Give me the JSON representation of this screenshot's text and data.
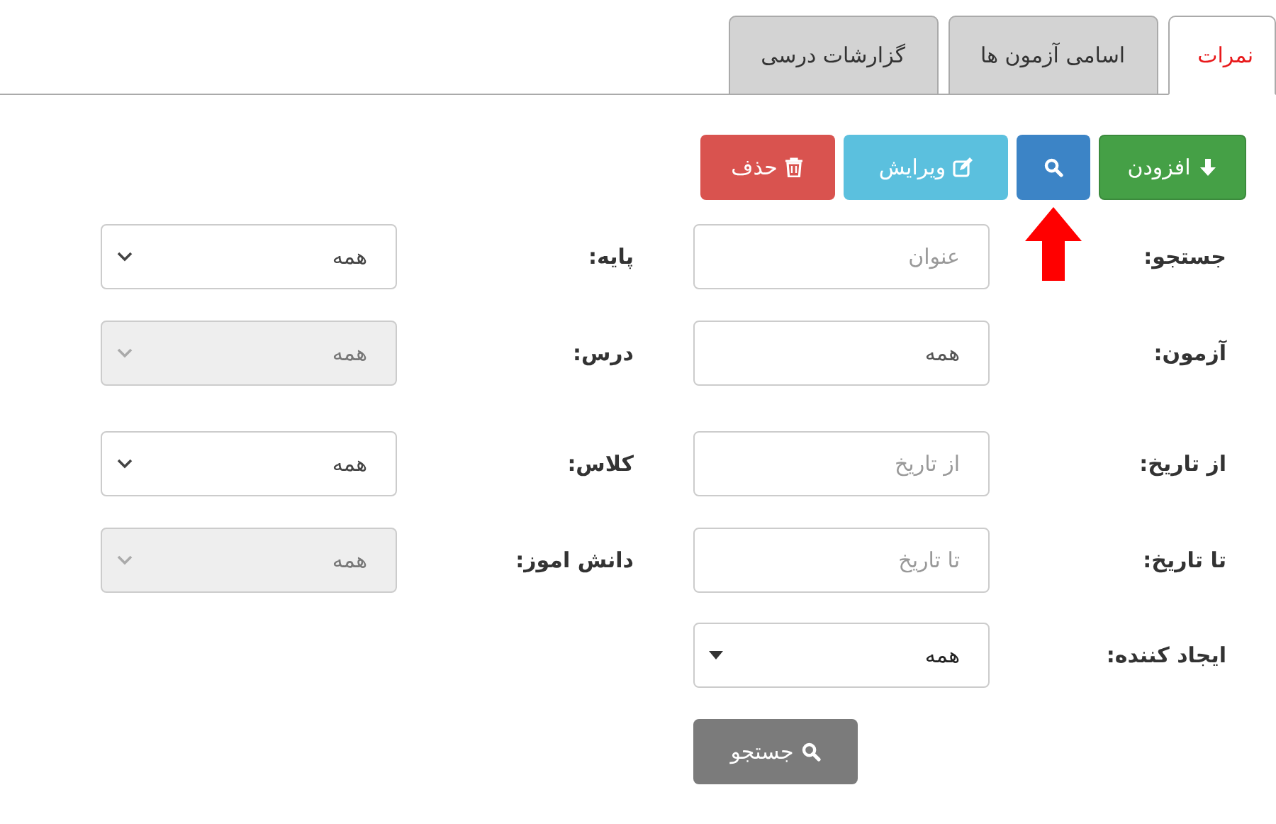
{
  "tabs": [
    {
      "label": "نمرات",
      "selected": true
    },
    {
      "label": "اسامی آزمون ها",
      "selected": false
    },
    {
      "label": "گزارشات درسی",
      "selected": false
    }
  ],
  "toolbar": [
    {
      "kind": "add",
      "label": "افزودن"
    },
    {
      "kind": "search"
    },
    {
      "kind": "edit",
      "label": "ویرایش"
    },
    {
      "kind": "delete",
      "label": "حذف"
    }
  ],
  "form": {
    "rows": [
      {
        "fields": [
          {
            "label": "جستجو:",
            "kind": "text",
            "placeholder": "عنوان"
          },
          {
            "label": "پایه:",
            "kind": "select",
            "value": "همه",
            "disabled": false
          }
        ]
      },
      {
        "fields": [
          {
            "label": "آزمون:",
            "kind": "text",
            "value": "همه"
          },
          {
            "label": "درس:",
            "kind": "select",
            "value": "همه",
            "disabled": true
          }
        ]
      },
      {
        "fields": [
          {
            "label": "از تاریخ:",
            "kind": "text",
            "placeholder": "از تاریخ"
          },
          {
            "label": "کلاس:",
            "kind": "select",
            "value": "همه",
            "disabled": false
          }
        ]
      },
      {
        "fields": [
          {
            "label": "تا تاریخ:",
            "kind": "text",
            "placeholder": "تا تاریخ"
          },
          {
            "label": "دانش اموز:",
            "kind": "select",
            "value": "همه",
            "disabled": true
          }
        ]
      },
      {
        "fields": [
          {
            "label": "ایجاد کننده:",
            "kind": "dropdown",
            "value": "همه"
          }
        ]
      }
    ],
    "submit": {
      "label": "جستجو"
    }
  }
}
